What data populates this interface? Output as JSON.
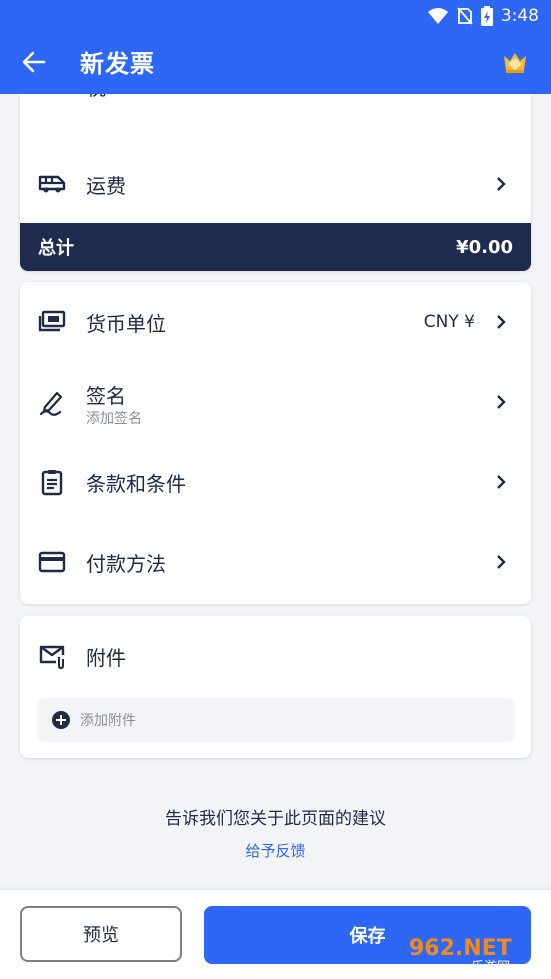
{
  "status_bar": {
    "time": "3:48"
  },
  "app_bar": {
    "title": "新发票"
  },
  "card1": {
    "tax_label": "税",
    "shipping_label": "运费",
    "total_label": "总计",
    "total_value": "¥0.00"
  },
  "card2": {
    "items": [
      {
        "label": "货币单位",
        "value": "CNY ¥"
      },
      {
        "label": "签名",
        "sub": "添加签名"
      },
      {
        "label": "条款和条件"
      },
      {
        "label": "付款方法"
      }
    ]
  },
  "attachments": {
    "label": "附件",
    "add_label": "添加附件"
  },
  "feedback": {
    "question": "告诉我们您关于此页面的建议",
    "link": "给予反馈"
  },
  "actions": {
    "preview": "预览",
    "save": "保存"
  },
  "watermark": {
    "text": "962.NET",
    "sub": "乐游网"
  },
  "colors": {
    "primary": "#2e67f6",
    "dark": "#1e2b4e",
    "background": "#f3f4f7"
  }
}
